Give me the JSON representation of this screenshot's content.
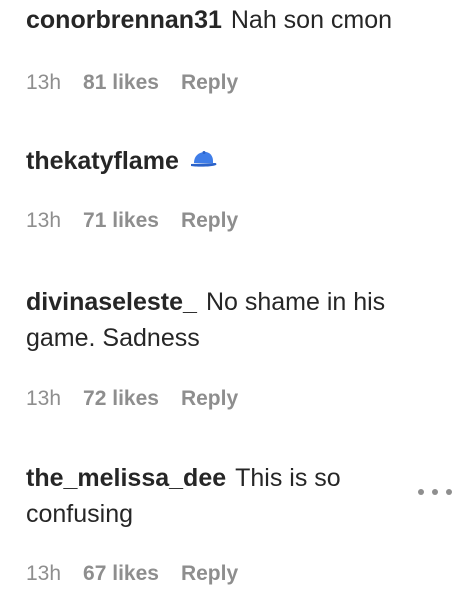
{
  "comments": [
    {
      "username": "conorbrennan31",
      "text": "Nah son cmon",
      "time": "13h",
      "likes": "81 likes",
      "reply": "Reply",
      "emoji_icon": ""
    },
    {
      "username": "thekatyflame",
      "text": "",
      "time": "13h",
      "likes": "71 likes",
      "reply": "Reply",
      "emoji_icon": "blue-cap-icon"
    },
    {
      "username": "divinaseleste_",
      "text": "No shame in his game. Sadness",
      "time": "13h",
      "likes": "72 likes",
      "reply": "Reply",
      "emoji_icon": ""
    },
    {
      "username": "the_melissa_dee",
      "text": "This is so confusing",
      "time": "13h",
      "likes": "67 likes",
      "reply": "Reply",
      "emoji_icon": ""
    }
  ],
  "colors": {
    "text": "#262626",
    "meta": "#8e8e8e",
    "cap_blue": "#3f7de8"
  }
}
